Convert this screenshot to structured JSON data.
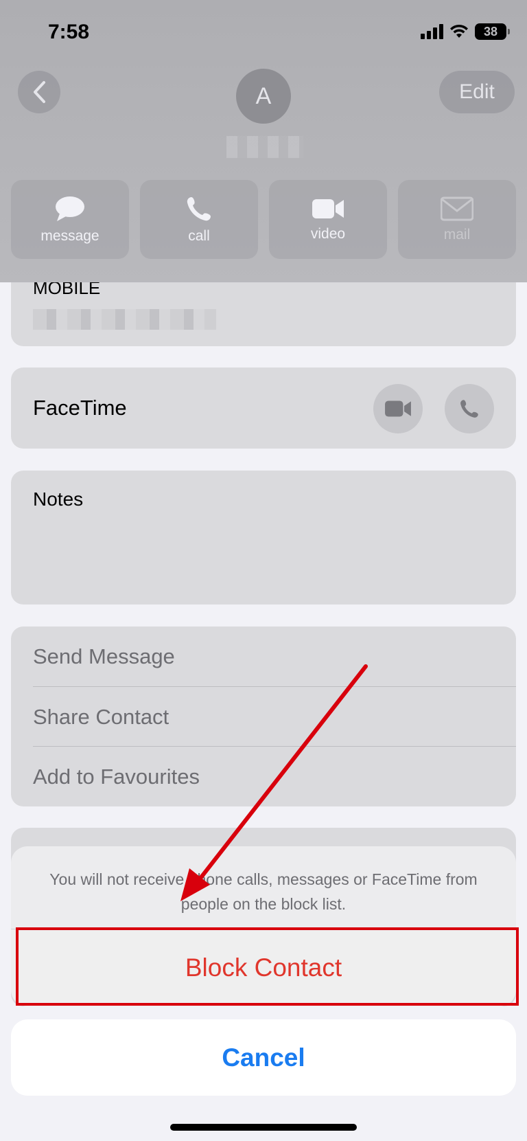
{
  "status_bar": {
    "time": "7:58",
    "battery": "38"
  },
  "header": {
    "avatar_initial": "A",
    "edit_label": "Edit"
  },
  "actions": [
    {
      "label": "message",
      "icon": "message-bubble-icon"
    },
    {
      "label": "call",
      "icon": "phone-icon"
    },
    {
      "label": "video",
      "icon": "video-camera-icon"
    },
    {
      "label": "mail",
      "icon": "envelope-icon"
    }
  ],
  "mobile": {
    "label": "MOBILE"
  },
  "facetime": {
    "label": "FaceTime"
  },
  "notes": {
    "label": "Notes"
  },
  "options": [
    "Send Message",
    "Share Contact",
    "Add to Favourites"
  ],
  "sheet": {
    "message": "You will not receive phone calls, messages or FaceTime from people on the block list.",
    "block_label": "Block Contact",
    "cancel_label": "Cancel"
  },
  "colors": {
    "destructive": "#e0362c",
    "link": "#1a7cf0",
    "annotation": "#d8000c"
  }
}
